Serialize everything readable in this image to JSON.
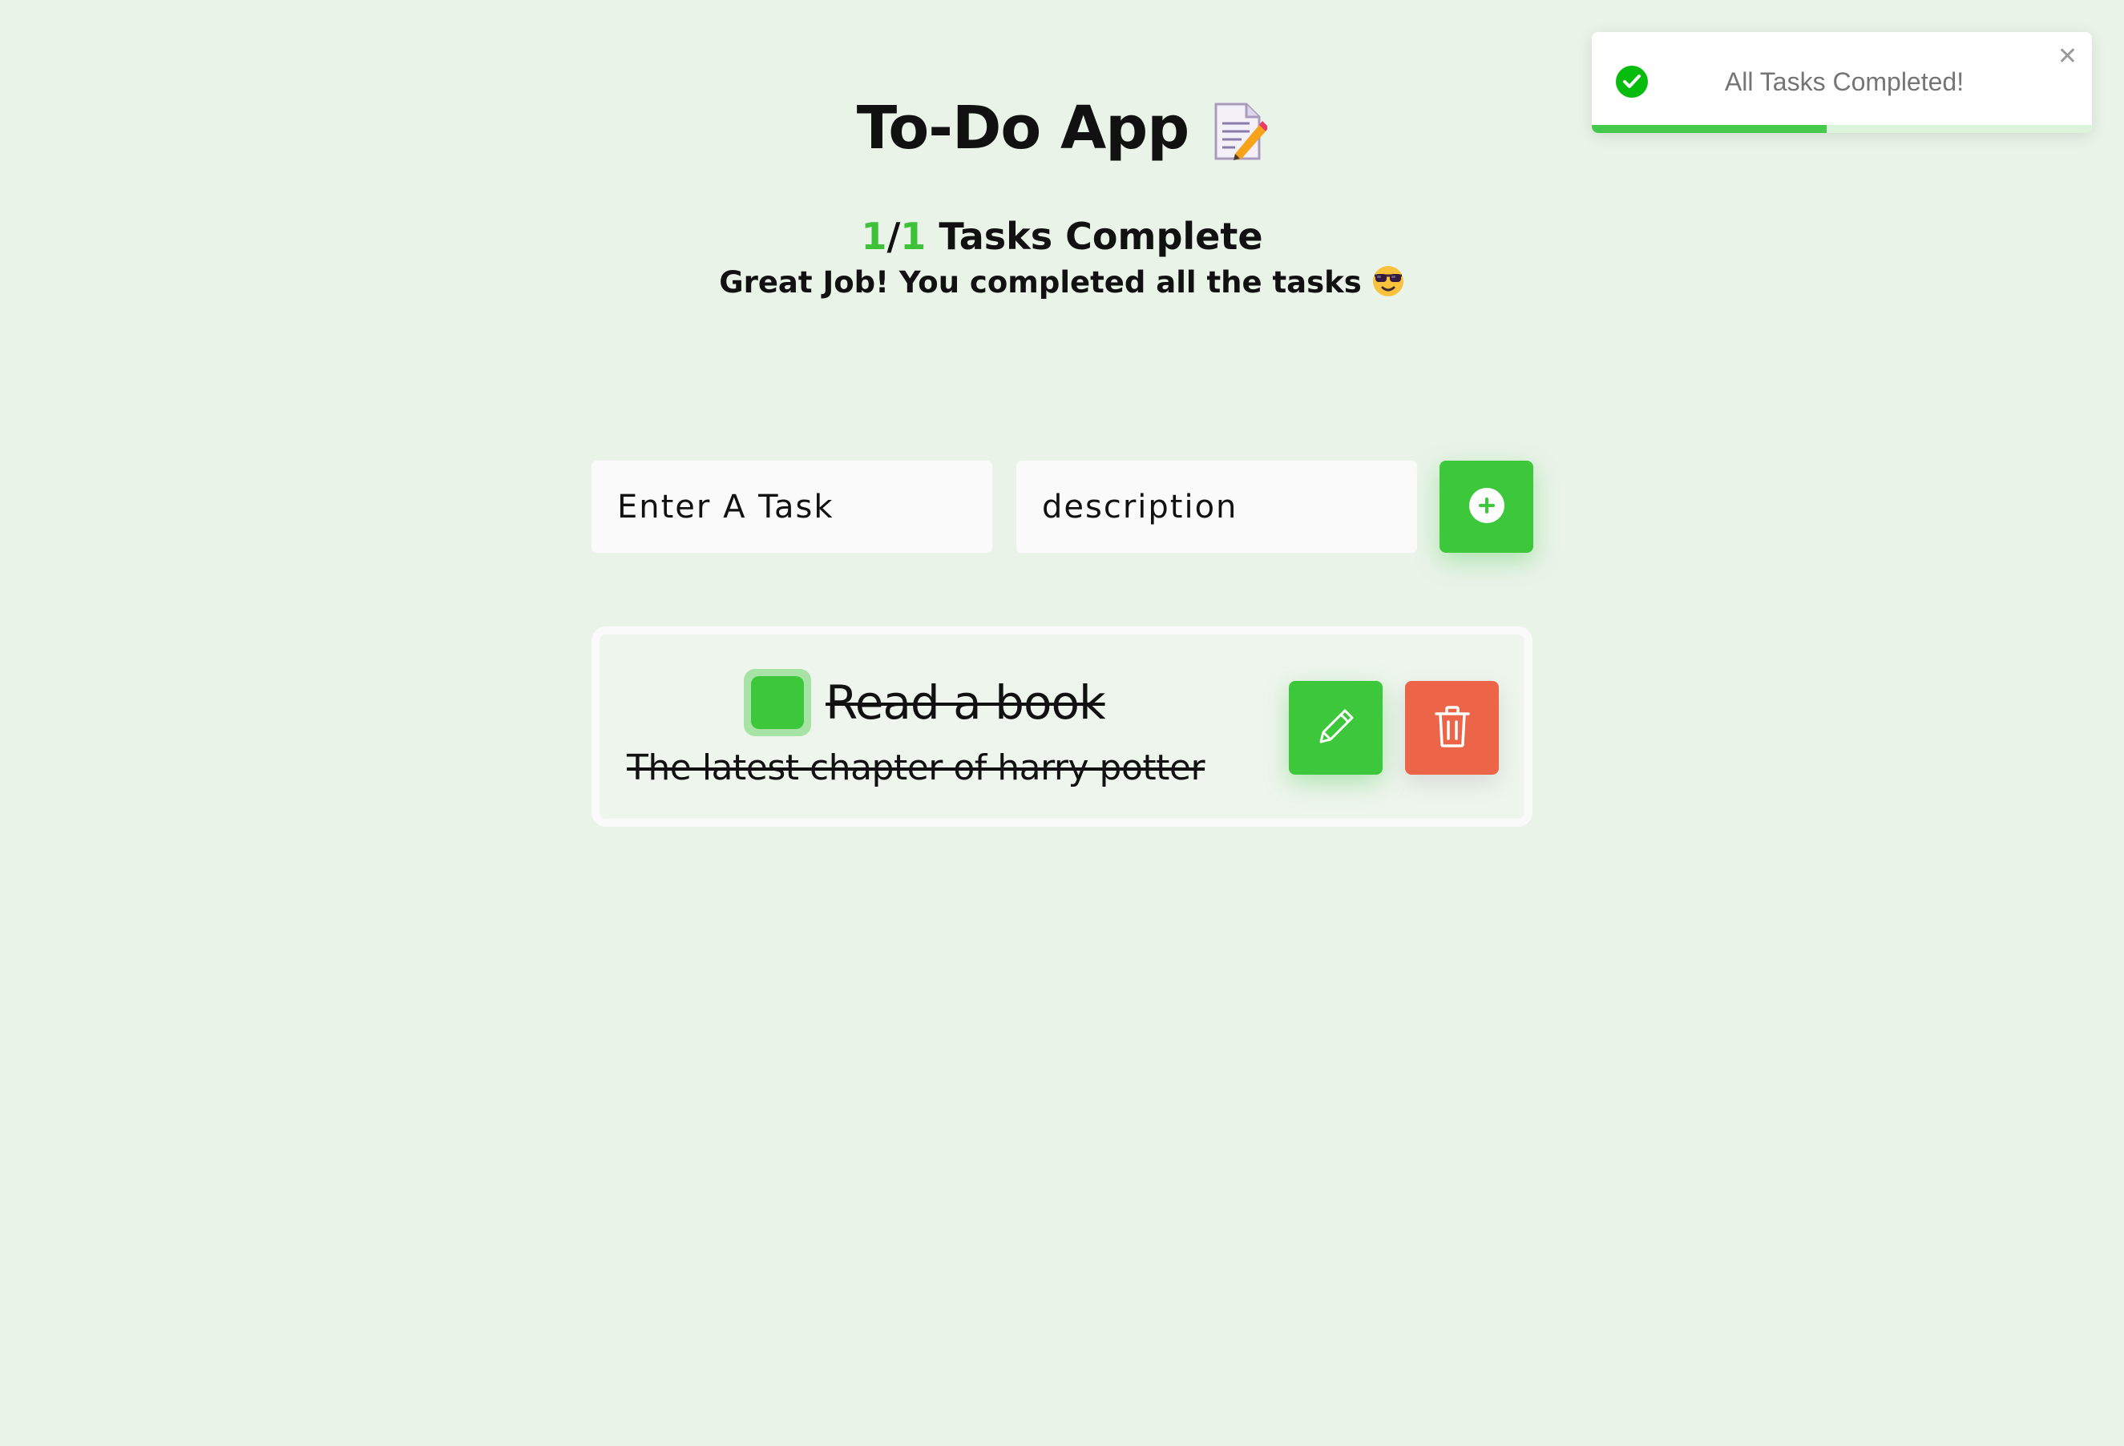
{
  "header": {
    "title": "To-Do App",
    "title_icon": "memo-emoji"
  },
  "stats": {
    "completed": "1",
    "separator": "/",
    "total": "1",
    "label": "Tasks Complete",
    "message": "Great Job! You completed all the tasks",
    "message_icon": "sunglasses-face-emoji"
  },
  "form": {
    "task_placeholder": "Enter A Task",
    "task_value": "",
    "description_placeholder": "description",
    "description_value": "",
    "add_icon": "plus-circle-icon"
  },
  "tasks": [
    {
      "title": "Read a book",
      "description": "The latest chapter of harry potter",
      "completed": true,
      "edit_icon": "pencil-icon",
      "delete_icon": "trash-icon"
    }
  ],
  "toast": {
    "message": "All Tasks Completed!",
    "icon": "check-circle-icon",
    "close_icon": "close-icon",
    "close_glyph": "✕",
    "progress": 0.47
  },
  "colors": {
    "background": "#e9f3e8",
    "accent_green": "#3dc73b",
    "danger": "#ec6548",
    "toast_success": "#07bc0c"
  }
}
